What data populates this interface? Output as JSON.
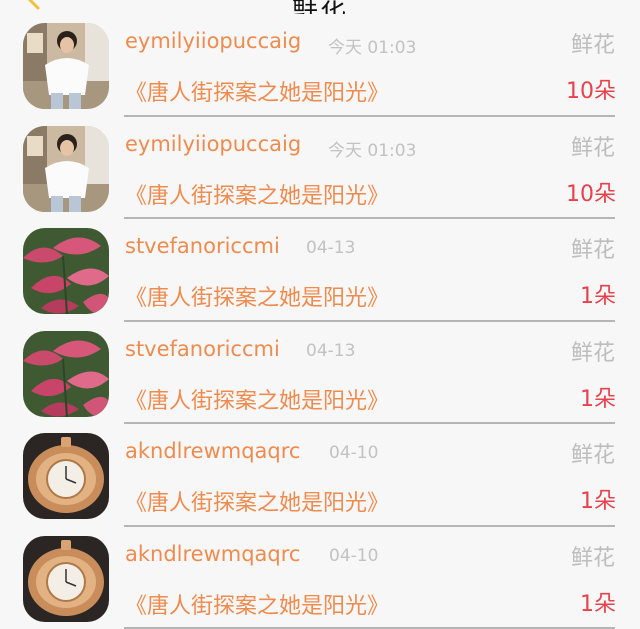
{
  "header": {
    "title": "鲜花"
  },
  "records": [
    {
      "username": "eymilyiiopuccaig",
      "time": "今天 01:03",
      "gift_type": "鲜花",
      "book_title": "《唐人街探案之她是阳光》",
      "count": "10朵",
      "avatar": "person-white-tshirt"
    },
    {
      "username": "eymilyiiopuccaig",
      "time": "今天 01:03",
      "gift_type": "鲜花",
      "book_title": "《唐人街探案之她是阳光》",
      "count": "10朵",
      "avatar": "person-white-tshirt"
    },
    {
      "username": "stvefanoriccmi",
      "time": "04-13",
      "gift_type": "鲜花",
      "book_title": "《唐人街探案之她是阳光》",
      "count": "1朵",
      "avatar": "pink-leaves"
    },
    {
      "username": "stvefanoriccmi",
      "time": "04-13",
      "gift_type": "鲜花",
      "book_title": "《唐人街探案之她是阳光》",
      "count": "1朵",
      "avatar": "pink-leaves"
    },
    {
      "username": "akndlrewmqaqrc",
      "time": "04-10",
      "gift_type": "鲜花",
      "book_title": "《唐人街探案之她是阳光》",
      "count": "1朵",
      "avatar": "gold-watch"
    },
    {
      "username": "akndlrewmqaqrc",
      "time": "04-10",
      "gift_type": "鲜花",
      "book_title": "《唐人街探案之她是阳光》",
      "count": "1朵",
      "avatar": "gold-watch"
    }
  ]
}
